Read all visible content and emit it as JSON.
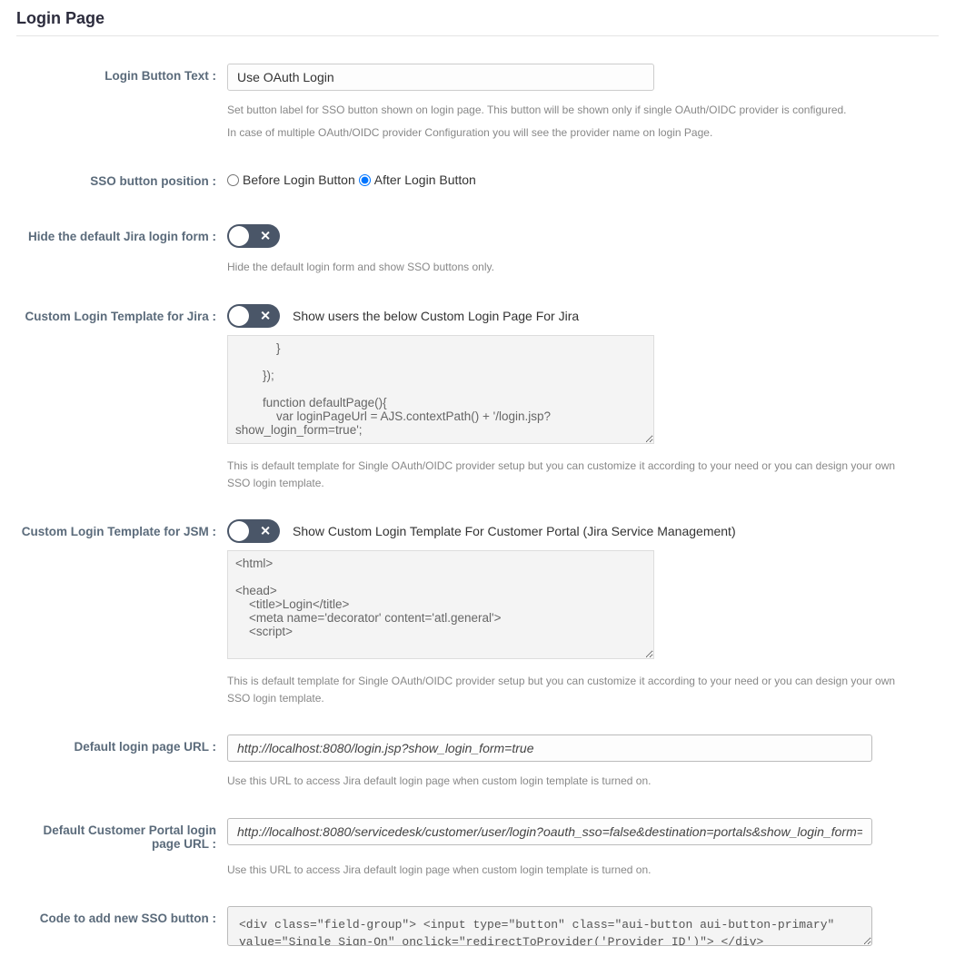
{
  "page": {
    "title": "Login Page"
  },
  "login_button_text": {
    "label": "Login Button Text :",
    "value": "Use OAuth Login",
    "help1": "Set button label for SSO button shown on login page. This button will be shown only if single OAuth/OIDC provider is configured.",
    "help2": "In case of multiple OAuth/OIDC provider Configuration you will see the provider name on login Page."
  },
  "sso_position": {
    "label": "SSO button position :",
    "options": {
      "before": "Before Login Button",
      "after": "After Login Button"
    },
    "selected": "after"
  },
  "hide_default": {
    "label": "Hide the default Jira login form :",
    "help": "Hide the default login form and show SSO buttons only."
  },
  "custom_jira": {
    "label": "Custom Login Template for Jira :",
    "toggle_text": "Show users the below Custom Login Page For Jira",
    "code": "            }\n\n        });\n\n        function defaultPage(){\n            var loginPageUrl = AJS.contextPath() + '/login.jsp?show_login_form=true';",
    "help": "This is default template for Single OAuth/OIDC provider setup but you can customize it according to your need or you can design your own SSO login template."
  },
  "custom_jsm": {
    "label": "Custom Login Template for JSM :",
    "toggle_text": "Show Custom Login Template For Customer Portal (Jira Service Management)",
    "code": "<html>\n\n<head>\n    <title>Login</title>\n    <meta name='decorator' content='atl.general'>\n    <script>",
    "help": "This is default template for Single OAuth/OIDC provider setup but you can customize it according to your need or you can design your own SSO login template."
  },
  "default_login_url": {
    "label": "Default login page URL :",
    "value": "http://localhost:8080/login.jsp?show_login_form=true",
    "help": "Use this URL to access Jira default login page when custom login template is turned on."
  },
  "default_portal_url": {
    "label": "Default Customer Portal login page URL :",
    "value": "http://localhost:8080/servicedesk/customer/user/login?oauth_sso=false&destination=portals&show_login_form=true",
    "help": "Use this URL to access Jira default login page when custom login template is turned on."
  },
  "sso_code": {
    "label": "Code to add new SSO button :",
    "value": "<div class=\"field-group\"> <input type=\"button\" class=\"aui-button aui-button-primary\" value=\"Single Sign-On\" onclick=\"redirectToProvider('Provider ID')\"> </div>"
  }
}
